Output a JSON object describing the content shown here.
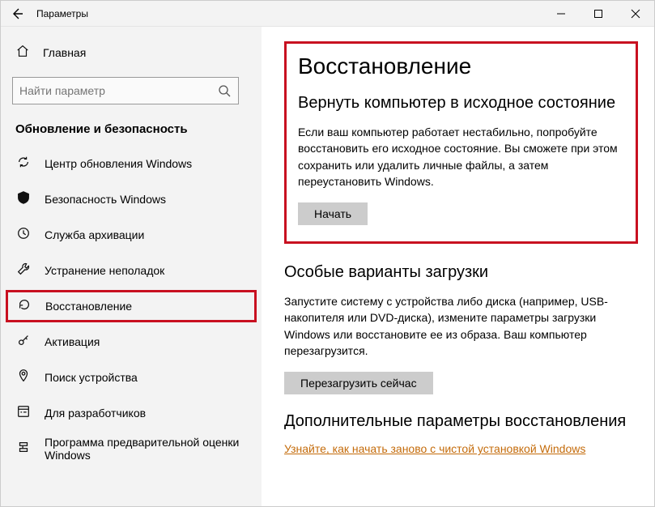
{
  "window": {
    "title": "Параметры"
  },
  "sidebar": {
    "home": "Главная",
    "search_placeholder": "Найти параметр",
    "section": "Обновление и безопасность",
    "items": [
      {
        "label": "Центр обновления Windows"
      },
      {
        "label": "Безопасность Windows"
      },
      {
        "label": "Служба архивации"
      },
      {
        "label": "Устранение неполадок"
      },
      {
        "label": "Восстановление"
      },
      {
        "label": "Активация"
      },
      {
        "label": "Поиск устройства"
      },
      {
        "label": "Для разработчиков"
      },
      {
        "label": "Программа предварительной оценки Windows"
      }
    ]
  },
  "main": {
    "heading": "Восстановление",
    "reset": {
      "title": "Вернуть компьютер в исходное состояние",
      "body": "Если ваш компьютер работает нестабильно, попробуйте восстановить его исходное состояние. Вы сможете при этом сохранить или удалить личные файлы, а затем переустановить Windows.",
      "button": "Начать"
    },
    "advanced": {
      "title": "Особые варианты загрузки",
      "body": "Запустите систему с устройства либо диска (например, USB-накопителя или DVD-диска), измените параметры загрузки Windows или восстановите ее из образа. Ваш компьютер перезагрузится.",
      "button": "Перезагрузить сейчас"
    },
    "more": {
      "title": "Дополнительные параметры восстановления",
      "link": "Узнайте, как начать заново с чистой установкой Windows"
    }
  }
}
